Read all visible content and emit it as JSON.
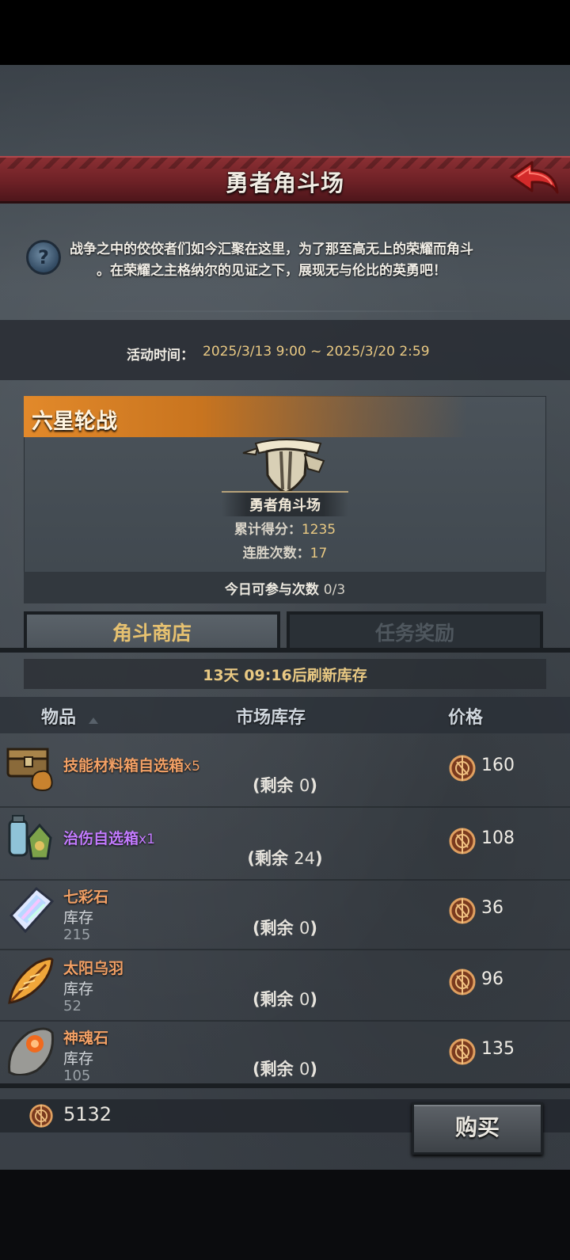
{
  "header": {
    "title": "勇者角斗场"
  },
  "description": {
    "line1": "战争之中的佼佼者们如今汇聚在这里，为了那至高无上的荣耀而角斗",
    "line2": "。在荣耀之主格纳尔的见证之下，展现无与伦比的英勇吧！"
  },
  "event": {
    "time_label": "活动时间：",
    "time_value": "2025/3/13 9:00 ~ 2025/3/20 2:59"
  },
  "arena": {
    "mode": "六星轮战",
    "name": "勇者角斗场",
    "score_label": "累计得分：",
    "score_value": "1235",
    "streak_label": "连胜次数：",
    "streak_value": "17",
    "today_label": "今日可参与次数",
    "today_value": "0/3"
  },
  "tabs": [
    {
      "label": "角斗商店",
      "active": true
    },
    {
      "label": "任务奖励",
      "active": false
    }
  ],
  "shop": {
    "refresh_text": "13天 09:16后刷新库存",
    "columns": {
      "item": "物品",
      "stock": "市场库存",
      "price": "价格"
    },
    "items": [
      {
        "name": "技能材料箱自选箱",
        "qty": "x5",
        "remain_label": "(剩余",
        "remain": "0",
        "price": "160",
        "color": "#f2a065"
      },
      {
        "name": "治伤自选箱",
        "qty": "x1",
        "remain_label": "(剩余",
        "remain": "24",
        "price": "108",
        "color": "#c37bff"
      },
      {
        "name": "七彩石",
        "stock_label": "库存",
        "stock": "215",
        "remain_label": "(剩余",
        "remain": "0",
        "price": "36",
        "color": "#f2a065"
      },
      {
        "name": "太阳乌羽",
        "stock_label": "库存",
        "stock": "52",
        "remain_label": "(剩余",
        "remain": "0",
        "price": "96",
        "color": "#f2a065"
      },
      {
        "name": "神魂石",
        "stock_label": "库存",
        "stock": "105",
        "remain_label": "(剩余",
        "remain": "0",
        "price": "135",
        "color": "#f2a065"
      }
    ]
  },
  "footer": {
    "balance": "5132",
    "buy_label": "购买"
  },
  "icons": [
    "back-arrow-icon",
    "help-icon",
    "shield-icon",
    "coin-icon",
    "chest-icon",
    "potion-icon",
    "crystal-icon",
    "feather-icon",
    "stone-icon"
  ]
}
